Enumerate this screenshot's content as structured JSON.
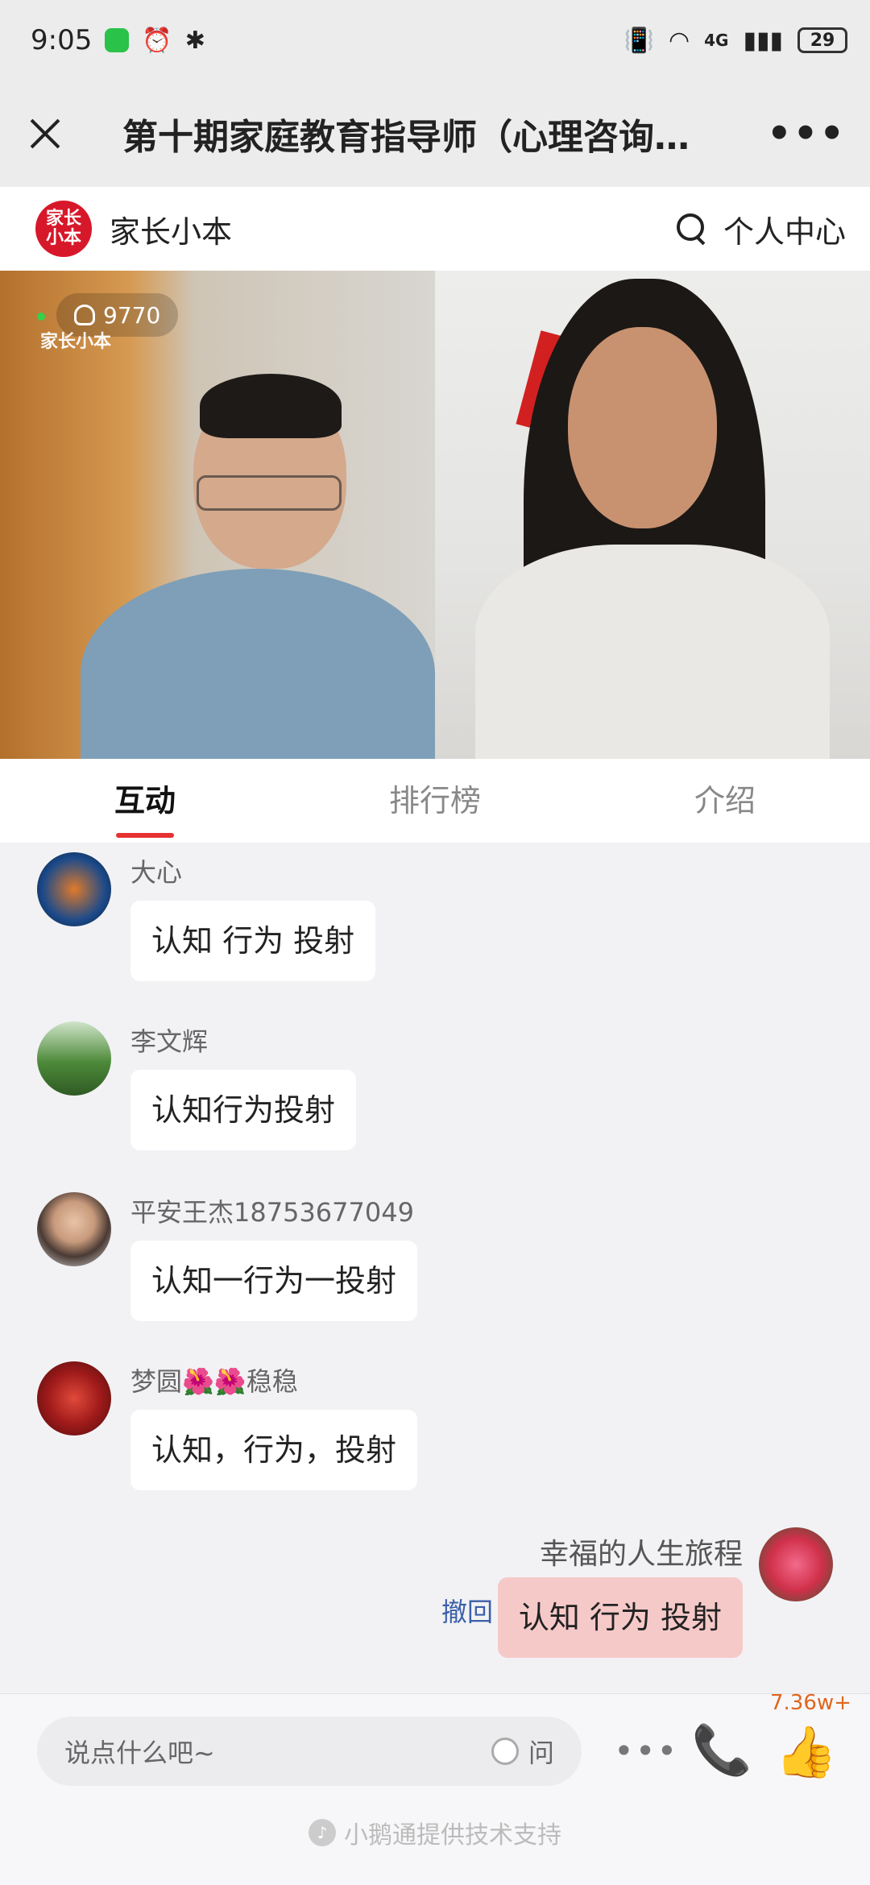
{
  "status_bar": {
    "time": "9:05",
    "battery": "29",
    "network": "4G"
  },
  "title_bar": {
    "title": "第十期家庭教育指导师（心理咨询…",
    "more": "•••"
  },
  "app_header": {
    "logo_text": "家长小本",
    "brand": "家长小本",
    "user_center": "个人中心"
  },
  "video": {
    "viewer_count": "9770",
    "watermark": "家长小本"
  },
  "tabs": [
    {
      "label": "互动",
      "active": true
    },
    {
      "label": "排行榜",
      "active": false
    },
    {
      "label": "介绍",
      "active": false
    }
  ],
  "messages": [
    {
      "name": "大心",
      "text": "认知 行为 投射",
      "mine": false
    },
    {
      "name": "李文辉",
      "text": "认知行为投射",
      "mine": false
    },
    {
      "name": "平安王杰18753677049",
      "text": "认知一行为一投射",
      "mine": false
    },
    {
      "name": "梦圆🌺🌺稳稳",
      "text": "认知，行为，投射",
      "mine": false
    },
    {
      "name": "幸福的人生旅程",
      "text": "认知 行为 投射",
      "mine": true,
      "action": "撤回"
    }
  ],
  "bottom": {
    "input_placeholder": "说点什么吧~",
    "ask_label": "问",
    "more": "•••",
    "like_count": "7.36w+",
    "support_text": "小鹅通提供技术支持"
  },
  "colors": {
    "accent": "#e63232",
    "brand": "#d7182a",
    "own_bubble": "#f6c9c9",
    "link": "#3b5fa8"
  }
}
